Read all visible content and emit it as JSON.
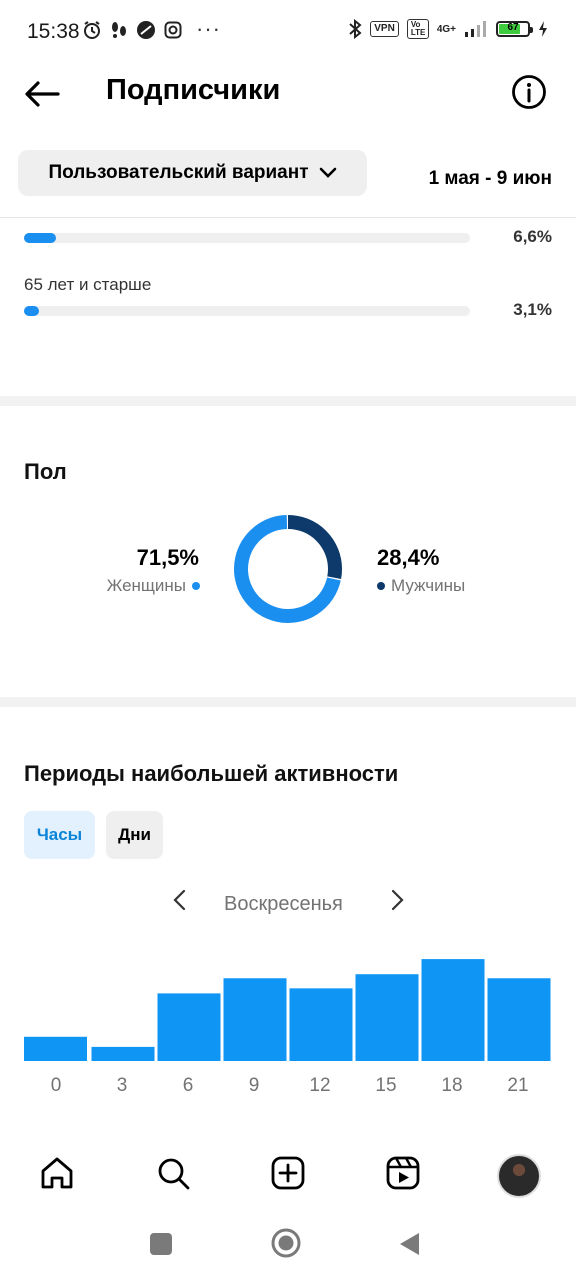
{
  "status_bar": {
    "time": "15:38",
    "dots": "···",
    "vpn": "VPN",
    "volte": "Vo LTE",
    "network": "4G+",
    "battery": "67"
  },
  "header": {
    "title": "Подписчики"
  },
  "filter": {
    "label": "Пользовательский вариант",
    "date_range": "1 мая - 9 июн"
  },
  "age": {
    "rows": [
      {
        "label": "",
        "percent_text": "6,6%",
        "percent": 6.6
      },
      {
        "label": "65 лет и старше",
        "percent_text": "3,1%",
        "percent": 3.1
      }
    ]
  },
  "gender": {
    "title": "Пол",
    "women": {
      "value": "71,5%",
      "label": "Женщины",
      "color": "#1b8ff0",
      "percent": 71.5
    },
    "men": {
      "value": "28,4%",
      "label": "Мужчины",
      "color": "#0d3a6b",
      "percent": 28.4
    }
  },
  "activity": {
    "title": "Периоды наибольшей активности",
    "tabs": [
      {
        "label": "Часы",
        "active": true
      },
      {
        "label": "Дни",
        "active": false
      }
    ],
    "day": "Воскресенья",
    "bar_color": "#0f96f5"
  },
  "chart_data": {
    "type": "bar",
    "categories": [
      "0",
      "3",
      "6",
      "9",
      "12",
      "15",
      "18",
      "21"
    ],
    "values": [
      24,
      14,
      67,
      82,
      72,
      86,
      101,
      82
    ],
    "ylim": [
      0,
      110
    ]
  },
  "bottom_nav": [
    "home-icon",
    "search-icon",
    "create-icon",
    "reels-icon",
    "profile-avatar"
  ],
  "system_nav": [
    "recents-square",
    "home-circle",
    "back-triangle"
  ]
}
